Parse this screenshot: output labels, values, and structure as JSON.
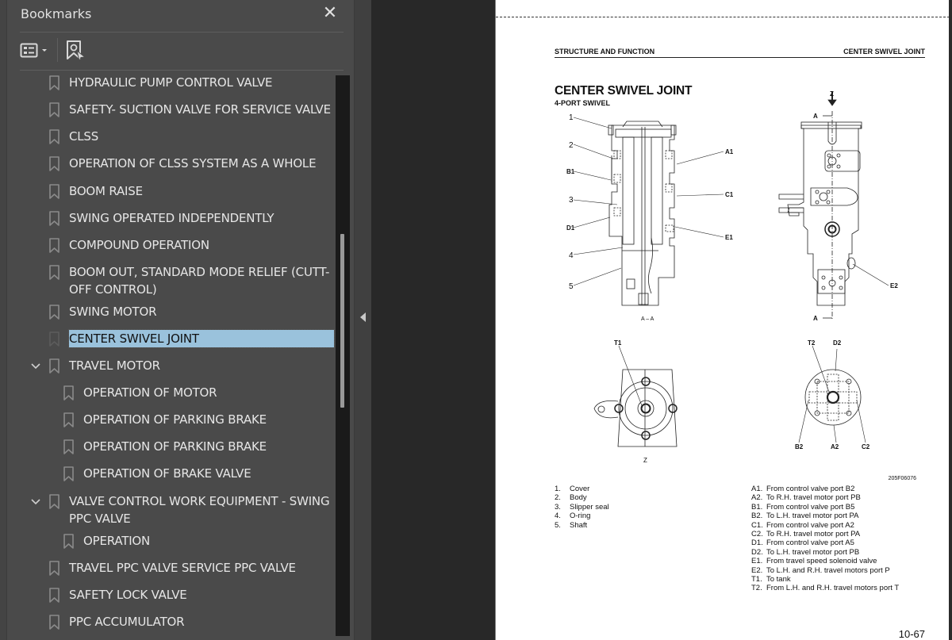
{
  "bookmarks_panel": {
    "title": "Bookmarks",
    "close_icon": "close-icon",
    "options_icon": "list-options-icon",
    "find_icon": "find-current-bookmark-icon",
    "scroll_position": 0.41,
    "scroll_visible_fraction": 0.31,
    "items": [
      {
        "label": "HYDRAULIC PUMP CONTROL VALVE",
        "level": 1,
        "expanded": null,
        "selected": false
      },
      {
        "label": "SAFETY- SUCTION VALVE FOR SERVICE VALVE",
        "level": 1,
        "expanded": null,
        "selected": false
      },
      {
        "label": "CLSS",
        "level": 1,
        "expanded": null,
        "selected": false
      },
      {
        "label": "OPERATION OF CLSS SYSTEM AS A WHOLE",
        "level": 1,
        "expanded": null,
        "selected": false
      },
      {
        "label": "BOOM RAISE",
        "level": 1,
        "expanded": null,
        "selected": false
      },
      {
        "label": "SWING OPERATED INDEPENDENTLY",
        "level": 1,
        "expanded": null,
        "selected": false
      },
      {
        "label": "COMPOUND OPERATION",
        "level": 1,
        "expanded": null,
        "selected": false
      },
      {
        "label": "BOOM OUT, STANDARD MODE RELIEF (CUTT-OFF CONTROL)",
        "level": 1,
        "expanded": null,
        "selected": false
      },
      {
        "label": "SWING MOTOR",
        "level": 1,
        "expanded": null,
        "selected": false
      },
      {
        "label": "CENTER SWIVEL JOINT",
        "level": 1,
        "expanded": null,
        "selected": true
      },
      {
        "label": "TRAVEL MOTOR",
        "level": 1,
        "expanded": true,
        "selected": false
      },
      {
        "label": "OPERATION OF MOTOR",
        "level": 2,
        "expanded": null,
        "selected": false
      },
      {
        "label": "OPERATION OF PARKING BRAKE",
        "level": 2,
        "expanded": null,
        "selected": false
      },
      {
        "label": "OPERATION OF PARKING BRAKE",
        "level": 2,
        "expanded": null,
        "selected": false
      },
      {
        "label": "OPERATION OF BRAKE VALVE",
        "level": 2,
        "expanded": null,
        "selected": false
      },
      {
        "label": "VALVE CONTROL WORK EQUIPMENT - SWING PPC VALVE",
        "level": 1,
        "expanded": true,
        "selected": false
      },
      {
        "label": "OPERATION",
        "level": 2,
        "expanded": null,
        "selected": false
      },
      {
        "label": "TRAVEL PPC VALVE SERVICE PPC VALVE",
        "level": 1,
        "expanded": null,
        "selected": false
      },
      {
        "label": "SAFETY LOCK VALVE",
        "level": 1,
        "expanded": null,
        "selected": false
      },
      {
        "label": "PPC ACCUMULATOR",
        "level": 1,
        "expanded": null,
        "selected": false
      }
    ]
  },
  "document": {
    "header_left": "STRUCTURE AND FUNCTION",
    "header_right": "CENTER SWIVEL JOINT",
    "title": "CENTER SWIVEL JOINT",
    "subtitle": "4-PORT SWIVEL",
    "section_label": "A – A",
    "view_label": "Z",
    "view_arrow_label": "Z",
    "cut_label": "A",
    "figure_code": "205F06076",
    "callouts_left": [
      "1",
      "2",
      "B1",
      "3",
      "D1",
      "4",
      "5"
    ],
    "callouts_right": [
      "A1",
      "C1",
      "E1"
    ],
    "callout_side_view": "E2",
    "callout_z_view": "T1",
    "callouts_bottom_right": [
      "T2",
      "D2",
      "B2",
      "A2",
      "C2"
    ],
    "parts": [
      {
        "num": "1.",
        "name": "Cover"
      },
      {
        "num": "2.",
        "name": "Body"
      },
      {
        "num": "3.",
        "name": "Slipper seal"
      },
      {
        "num": "4.",
        "name": "O-ring"
      },
      {
        "num": "5.",
        "name": "Shaft"
      }
    ],
    "ports": [
      {
        "code": "A1.",
        "desc": "From control valve port B2"
      },
      {
        "code": "A2.",
        "desc": "To R.H. travel motor port PB"
      },
      {
        "code": "B1.",
        "desc": "From control valve port B5"
      },
      {
        "code": "B2.",
        "desc": "To L.H. travel motor port PA"
      },
      {
        "code": "C1.",
        "desc": "From control valve port A2"
      },
      {
        "code": "C2.",
        "desc": "To R.H. travel motor port PA"
      },
      {
        "code": "D1.",
        "desc": "From control valve port A5"
      },
      {
        "code": "D2.",
        "desc": "To L.H. travel motor port PB"
      },
      {
        "code": "E1.",
        "desc": "From travel speed solenoid valve"
      },
      {
        "code": "E2.",
        "desc": "To L.H. and R.H. travel motors port P"
      },
      {
        "code": "T1.",
        "desc": "To tank"
      },
      {
        "code": "T2.",
        "desc": "From L.H. and R.H. travel motors port T"
      }
    ],
    "page_number": "10-67"
  },
  "colors": {
    "panel_bg": "#4a4a4a",
    "selection_bg": "#9ac2dc",
    "viewer_bg": "#282828",
    "text": "#e6e6e6"
  }
}
